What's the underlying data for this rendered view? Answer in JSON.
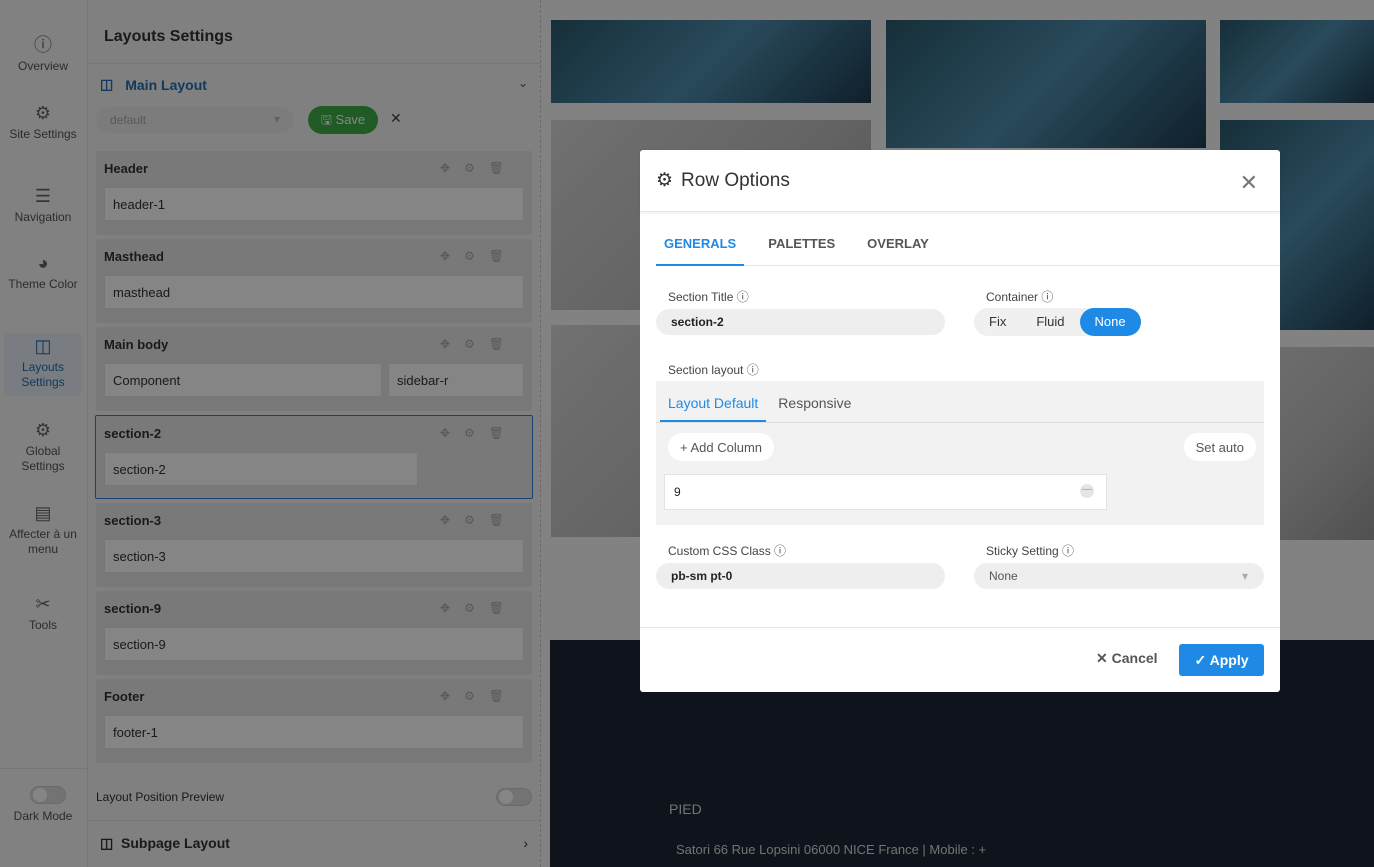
{
  "nav": [
    {
      "label": "Overview",
      "icon": "ⓘ"
    },
    {
      "label": "Site Settings",
      "icon": "⚙"
    },
    {
      "label": "Navigation",
      "icon": "☰"
    },
    {
      "label": "Theme Color",
      "icon": "◕"
    },
    {
      "label": "Layouts Settings",
      "icon": "◫"
    },
    {
      "label": "Global Settings",
      "icon": "⚙"
    },
    {
      "label": "Affecter à un menu",
      "icon": "▤"
    },
    {
      "label": "Tools",
      "icon": "✂"
    }
  ],
  "dark_mode": "Dark Mode",
  "panel": {
    "title": "Layouts Settings",
    "main_layout": "Main Layout",
    "select_value": "default",
    "save": "Save",
    "blocks": [
      {
        "title": "Header",
        "fields": [
          "header-1"
        ]
      },
      {
        "title": "Masthead",
        "fields": [
          "masthead"
        ]
      },
      {
        "title": "Main body",
        "fields": [
          "Component",
          "sidebar-r"
        ]
      },
      {
        "title": "section-2",
        "fields": [
          "section-2"
        ]
      },
      {
        "title": "section-3",
        "fields": [
          "section-3"
        ]
      },
      {
        "title": "section-9",
        "fields": [
          "section-9"
        ]
      },
      {
        "title": "Footer",
        "fields": [
          "footer-1"
        ]
      }
    ],
    "layout_position_preview": "Layout Position Preview",
    "subpage_layout": "Subpage Layout"
  },
  "footer": {
    "heading": "PIED",
    "address": "Satori 66 Rue Lopsini 06000 NICE France | Mobile : +"
  },
  "modal": {
    "title": "Row Options",
    "tabs": [
      "GENERALS",
      "PALETTES",
      "OVERLAY"
    ],
    "section_title_label": "Section Title",
    "section_title": "section-2",
    "container_label": "Container",
    "container_options": [
      "Fix",
      "Fluid",
      "None"
    ],
    "container_selected": "None",
    "section_layout_label": "Section layout",
    "layout_tabs": [
      "Layout Default",
      "Responsive"
    ],
    "add_column": "+ Add Column",
    "set_auto": "Set auto",
    "column_value": "9",
    "css_class_label": "Custom CSS Class",
    "css_class": "pb-sm pt-0",
    "sticky_label": "Sticky Setting",
    "sticky_value": "None",
    "cancel": "✕ Cancel",
    "apply": "✓ Apply"
  },
  "colors": {
    "accent": "#1f8ae6",
    "save": "#3fae49"
  }
}
